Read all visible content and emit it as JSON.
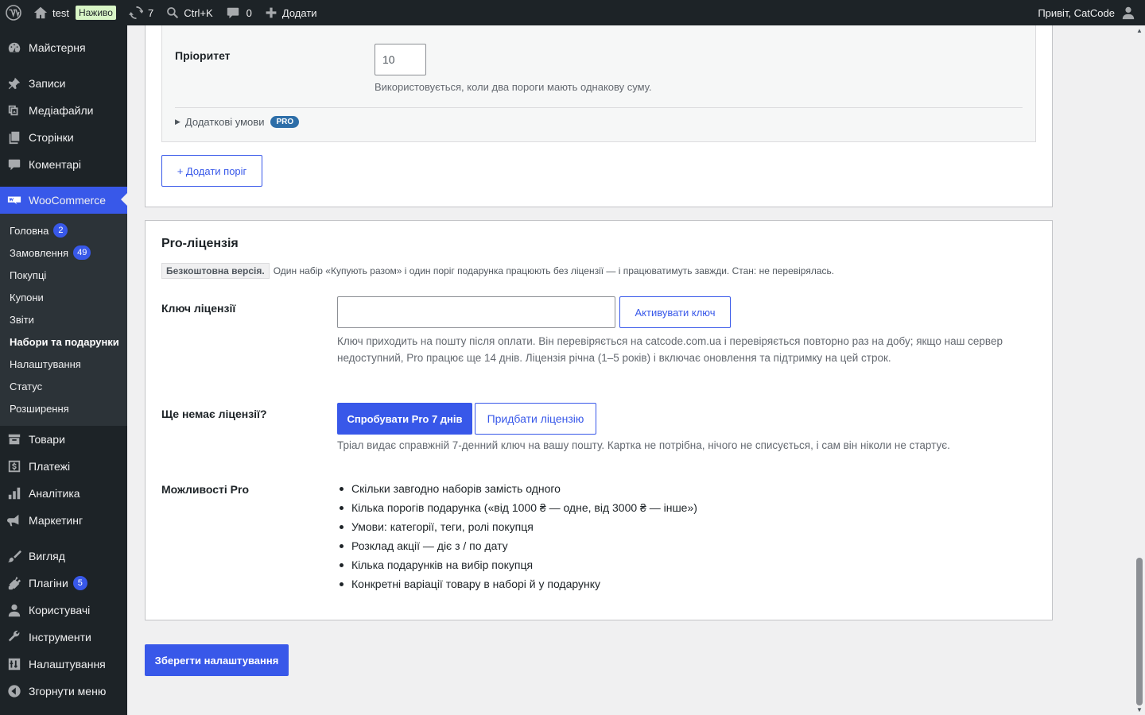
{
  "adminbar": {
    "site_name": "test",
    "live_label": "Наживо",
    "updates_count": "7",
    "search_shortcut": "Ctrl+K",
    "comments_count": "0",
    "add_label": "Додати",
    "greeting": "Привіт, CatCode"
  },
  "sidebar": {
    "dashboard": "Майстерня",
    "posts": "Записи",
    "media": "Медіафайли",
    "pages": "Сторінки",
    "comments": "Коментарі",
    "woocommerce": "WooCommerce",
    "woo_sub": [
      {
        "label": "Головна",
        "badge": "2"
      },
      {
        "label": "Замовлення",
        "badge": "49"
      },
      {
        "label": "Покупці",
        "badge": null
      },
      {
        "label": "Купони",
        "badge": null
      },
      {
        "label": "Звіти",
        "badge": null
      },
      {
        "label": "Набори та подарунки",
        "badge": null
      },
      {
        "label": "Налаштування",
        "badge": null
      },
      {
        "label": "Статус",
        "badge": null
      },
      {
        "label": "Розширення",
        "badge": null
      }
    ],
    "products": "Товари",
    "payments": "Платежі",
    "analytics": "Аналітика",
    "marketing": "Маркетинг",
    "appearance": "Вигляд",
    "plugins": "Плагіни",
    "plugins_badge": "5",
    "users": "Користувачі",
    "tools": "Інструменти",
    "settings": "Налаштування",
    "collapse": "Згорнути меню"
  },
  "threshold": {
    "priority_label": "Пріоритет",
    "priority_value": "10",
    "priority_desc": "Використовується, коли два пороги мають однакову суму.",
    "extra_conditions": "Додаткові умови",
    "pro_tag": "PRO",
    "add_threshold": "+ Додати поріг"
  },
  "license": {
    "title": "Pro-ліцензія",
    "free_version": "Безкоштовна версія.",
    "free_desc": "Один набір «Купують разом» і один поріг подарунка працюють без ліцензії — і працюватимуть завжди. Стан: не перевірялась.",
    "key_label": "Ключ ліцензії",
    "key_value": "",
    "activate_button": "Активувати ключ",
    "key_desc_line1": "Ключ приходить на пошту після оплати. Він перевіряється на catcode.com.ua і перевіряється повторно раз на добу; якщо наш сервер",
    "key_desc_line2": "недоступний, Pro працює ще 14 днів. Ліцензія річна (1–5 років) і включає оновлення та підтримку на цей строк.",
    "no_license_label": "Ще немає ліцензії?",
    "try_button": "Спробувати Pro 7 днів",
    "buy_button": "Придбати ліцензію",
    "trial_desc": "Тріал видає справжній 7-денний ключ на вашу пошту. Картка не потрібна, нічого не списується, і сам він ніколи не стартує.",
    "features_label": "Можливості Pro",
    "features": [
      "Скільки завгодно наборів замість одного",
      "Кілька порогів подарунка («від 1000 ₴ — одне, від 3000 ₴ — інше»)",
      "Умови: категорії, теги, ролі покупця",
      "Розклад акції — діє з / по дату",
      "Кілька подарунків на вибір покупця",
      "Конкретні варіації товару в наборі й у подарунку"
    ]
  },
  "save_button": "Зберегти налаштування"
}
